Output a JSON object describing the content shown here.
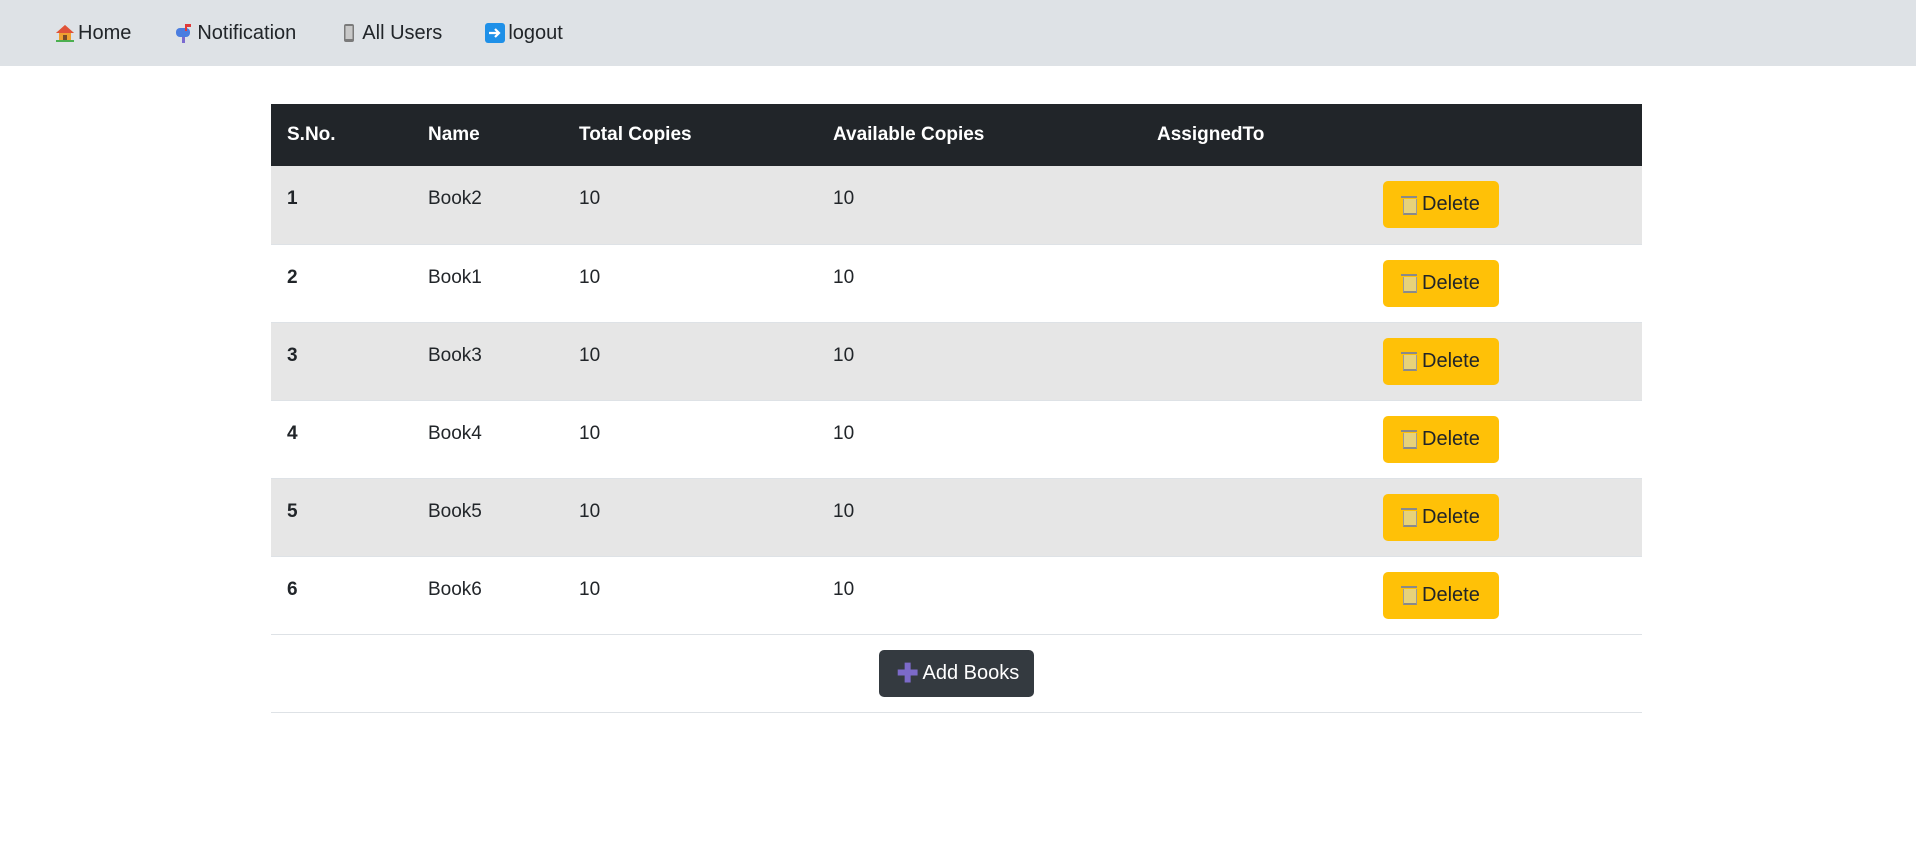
{
  "nav": {
    "items": [
      {
        "label": "Home",
        "icon": "house-icon"
      },
      {
        "label": "Notification",
        "icon": "mailbox-icon"
      },
      {
        "label": "All Users",
        "icon": "phone-icon"
      },
      {
        "label": "logout",
        "icon": "arrow-right-icon"
      }
    ]
  },
  "table": {
    "headers": [
      "S.No.",
      "Name",
      "Total Copies",
      "Available Copies",
      "AssignedTo",
      ""
    ],
    "rows": [
      {
        "sno": "1",
        "name": "Book2",
        "total": "10",
        "available": "10",
        "assigned": "",
        "action": "Delete"
      },
      {
        "sno": "2",
        "name": "Book1",
        "total": "10",
        "available": "10",
        "assigned": "",
        "action": "Delete"
      },
      {
        "sno": "3",
        "name": "Book3",
        "total": "10",
        "available": "10",
        "assigned": "",
        "action": "Delete"
      },
      {
        "sno": "4",
        "name": "Book4",
        "total": "10",
        "available": "10",
        "assigned": "",
        "action": "Delete"
      },
      {
        "sno": "5",
        "name": "Book5",
        "total": "10",
        "available": "10",
        "assigned": "",
        "action": "Delete"
      },
      {
        "sno": "6",
        "name": "Book6",
        "total": "10",
        "available": "10",
        "assigned": "",
        "action": "Delete"
      }
    ]
  },
  "add_button_label": "Add Books",
  "colors": {
    "navbar_bg": "#dee2e6",
    "table_header_bg": "#212529",
    "delete_button": "#ffc107",
    "add_button": "#343a40"
  }
}
